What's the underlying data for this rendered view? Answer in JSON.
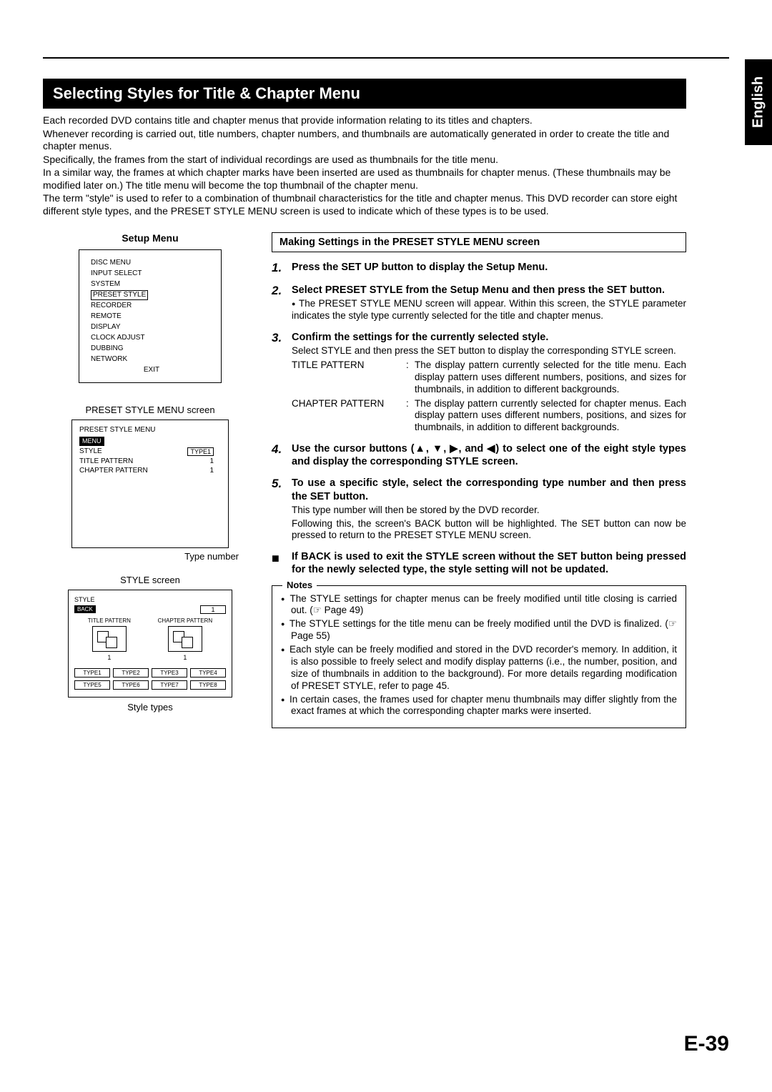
{
  "language_tab": "English",
  "banner": "Selecting Styles for Title & Chapter Menu",
  "intro": [
    "Each recorded DVD contains title and chapter menus that provide information relating to its titles and chapters.",
    "Whenever recording is carried out, title numbers, chapter numbers, and thumbnails are automatically generated in order to create the title and chapter menus.",
    "Specifically, the frames from the start of individual recordings are used as thumbnails for the title menu.",
    "In a similar way, the frames at which chapter marks have been inserted are used as thumbnails for chapter menus. (These thumbnails may be modified later on.) The title menu will become the top thumbnail of the chapter menu.",
    "The term \"style\" is used to refer to a combination of thumbnail characteristics for the title and chapter menus. This DVD recorder can store eight different style types, and the PRESET STYLE MENU screen is used to indicate which of these types is to be used."
  ],
  "setup": {
    "heading": "Setup Menu",
    "items": [
      "DISC MENU",
      "INPUT SELECT",
      "SYSTEM",
      "PRESET STYLE",
      "RECORDER",
      "REMOTE",
      "DISPLAY",
      "CLOCK ADJUST",
      "DUBBING",
      "NETWORK"
    ],
    "selected_index": 3,
    "exit": "EXIT"
  },
  "preset": {
    "caption": "PRESET STYLE MENU screen",
    "title": "PRESET STYLE MENU",
    "menu_btn": "MENU",
    "rows": [
      {
        "label": "STYLE",
        "value": "TYPE1",
        "boxed": true
      },
      {
        "label": "TITLE PATTERN",
        "value": "1"
      },
      {
        "label": "CHAPTER PATTERN",
        "value": "1"
      }
    ],
    "type_number_label": "Type number"
  },
  "style_screen": {
    "caption": "STYLE screen",
    "hdr": "STYLE",
    "back": "BACK",
    "num": "1",
    "title_pattern": "TITLE PATTERN",
    "chapter_pattern": "CHAPTER PATTERN",
    "pv1": "1",
    "pv2": "1",
    "types": [
      "TYPE1",
      "TYPE2",
      "TYPE3",
      "TYPE4",
      "TYPE5",
      "TYPE6",
      "TYPE7",
      "TYPE8"
    ],
    "style_types_label": "Style types"
  },
  "section_title": "Making Settings in the PRESET STYLE MENU screen",
  "steps": {
    "s1": {
      "num": "1.",
      "title": "Press the SET UP button to display the Setup Menu."
    },
    "s2": {
      "num": "2.",
      "title": "Select PRESET STYLE from the Setup Menu and then press the SET button.",
      "sub": "The PRESET STYLE MENU screen will appear. Within this screen, the STYLE parameter indicates the style type currently selected for the title and chapter menus."
    },
    "s3": {
      "num": "3.",
      "title": "Confirm the settings for the currently selected style.",
      "sub": "Select STYLE and then press the SET button to display the corresponding STYLE screen.",
      "defs": [
        {
          "dt": "TITLE PATTERN",
          "dd": "The display pattern currently selected for the title menu. Each display pattern uses different numbers, positions, and sizes for thumbnails, in addition to different backgrounds."
        },
        {
          "dt": "CHAPTER PATTERN",
          "dd": "The display pattern currently selected for chapter menus. Each display pattern uses different numbers, positions, and sizes for thumbnails, in addition to different backgrounds."
        }
      ]
    },
    "s4": {
      "num": "4.",
      "title": "Use the cursor buttons (▲, ▼, ▶, and ◀) to select one of the eight style types and display the corresponding STYLE screen."
    },
    "s5": {
      "num": "5.",
      "title": "To use a specific style, select the corresponding type number and then press the SET button.",
      "sub1": "This type number will then be stored by the DVD recorder.",
      "sub2": "Following this, the screen's BACK button will be highlighted. The SET button can now be pressed to return to the PRESET STYLE MENU screen."
    },
    "back_note": "If BACK is used to exit the STYLE screen without the SET button being pressed for the newly selected type, the style setting will not be updated."
  },
  "notes": {
    "legend": "Notes",
    "items": [
      "The STYLE settings for chapter menus can be freely modified until title closing is carried out. (☞ Page 49)",
      "The STYLE settings for the title menu can be freely modified until the DVD is finalized. (☞ Page 55)",
      "Each style can be freely modified and stored in the DVD recorder's memory. In addition, it is also possible to freely select and modify display patterns (i.e., the number, position, and size of thumbnails in addition to the background). For more details regarding modification of PRESET STYLE, refer to page 45.",
      "In certain cases, the frames used for chapter menu thumbnails may differ slightly from the exact frames at which the corresponding chapter marks were inserted."
    ]
  },
  "page_num": "E-39"
}
